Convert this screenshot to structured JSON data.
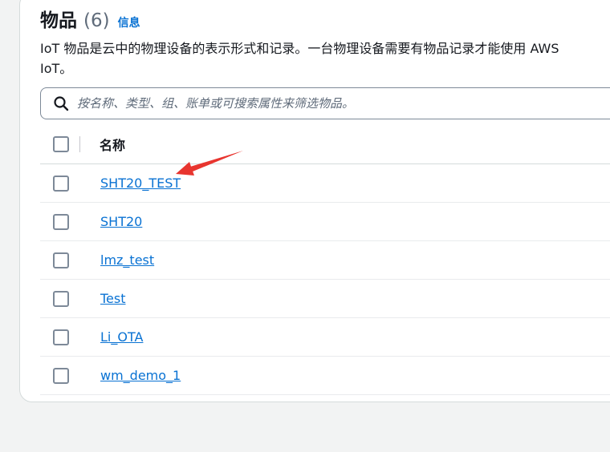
{
  "header": {
    "title": "物品",
    "count": "(6)",
    "info_label": "信息"
  },
  "description": "IoT 物品是云中的物理设备的表示形式和记录。一台物理设备需要有物品记录才能使用 AWS IoT。",
  "search": {
    "placeholder": "按名称、类型、组、账单或可搜索属性来筛选物品。",
    "icon": "search-icon"
  },
  "table": {
    "columns": [
      "名称"
    ],
    "rows": [
      {
        "name": "SHT20_TEST"
      },
      {
        "name": "SHT20"
      },
      {
        "name": "lmz_test"
      },
      {
        "name": "Test"
      },
      {
        "name": "Li_OTA"
      },
      {
        "name": "wm_demo_1"
      }
    ]
  },
  "colors": {
    "link": "#0972d3",
    "annotation_arrow": "#e8352f"
  }
}
